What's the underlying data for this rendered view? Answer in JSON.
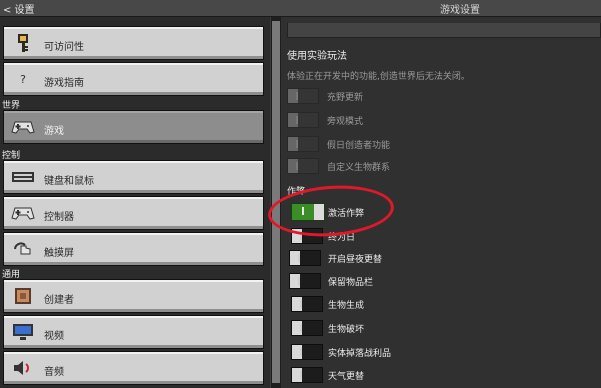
{
  "header": {
    "back_label": "< 设置",
    "panel_title": "游戏设置"
  },
  "sidebar": {
    "items_top": [
      {
        "label": "可访问性",
        "icon": "key-icon"
      },
      {
        "label": "游戏指南",
        "icon": "question-icon"
      }
    ],
    "section_world": "世界",
    "item_game": {
      "label": "游戏",
      "icon": "controller-icon"
    },
    "section_controls": "控制",
    "controls_items": [
      {
        "label": "键盘和鼠标",
        "icon": "keyboard-icon"
      },
      {
        "label": "控制器",
        "icon": "controller-icon"
      },
      {
        "label": "触摸屏",
        "icon": "touch-icon"
      }
    ],
    "section_general": "通用",
    "general_items": [
      {
        "label": "创建者",
        "icon": "block-icon"
      },
      {
        "label": "视频",
        "icon": "monitor-icon"
      },
      {
        "label": "音频",
        "icon": "speaker-icon"
      }
    ]
  },
  "settings": {
    "experimental_title": "使用实验玩法",
    "experimental_desc": "体验正在开发中的功能,创造世界后无法关闭。",
    "experimental_toggles": [
      {
        "label": "充野更新",
        "state": "off-disabled"
      },
      {
        "label": "旁观模式",
        "state": "off-disabled"
      },
      {
        "label": "假日创造者功能",
        "state": "off-disabled"
      },
      {
        "label": "自定义生物群系",
        "state": "off-disabled"
      }
    ],
    "cheats_title": "作弊",
    "cheat_toggles": [
      {
        "label": "激活作弊",
        "state": "on"
      },
      {
        "label": "终为日",
        "state": "off"
      },
      {
        "label": "开启昼夜更替",
        "state": "off"
      },
      {
        "label": "保留物品栏",
        "state": "off"
      },
      {
        "label": "生物生成",
        "state": "off"
      },
      {
        "label": "生物破坏",
        "state": "off"
      },
      {
        "label": "实体掉落战利品",
        "state": "off"
      },
      {
        "label": "天气更替",
        "state": "off"
      }
    ]
  },
  "annotation_color": "#e0192a"
}
